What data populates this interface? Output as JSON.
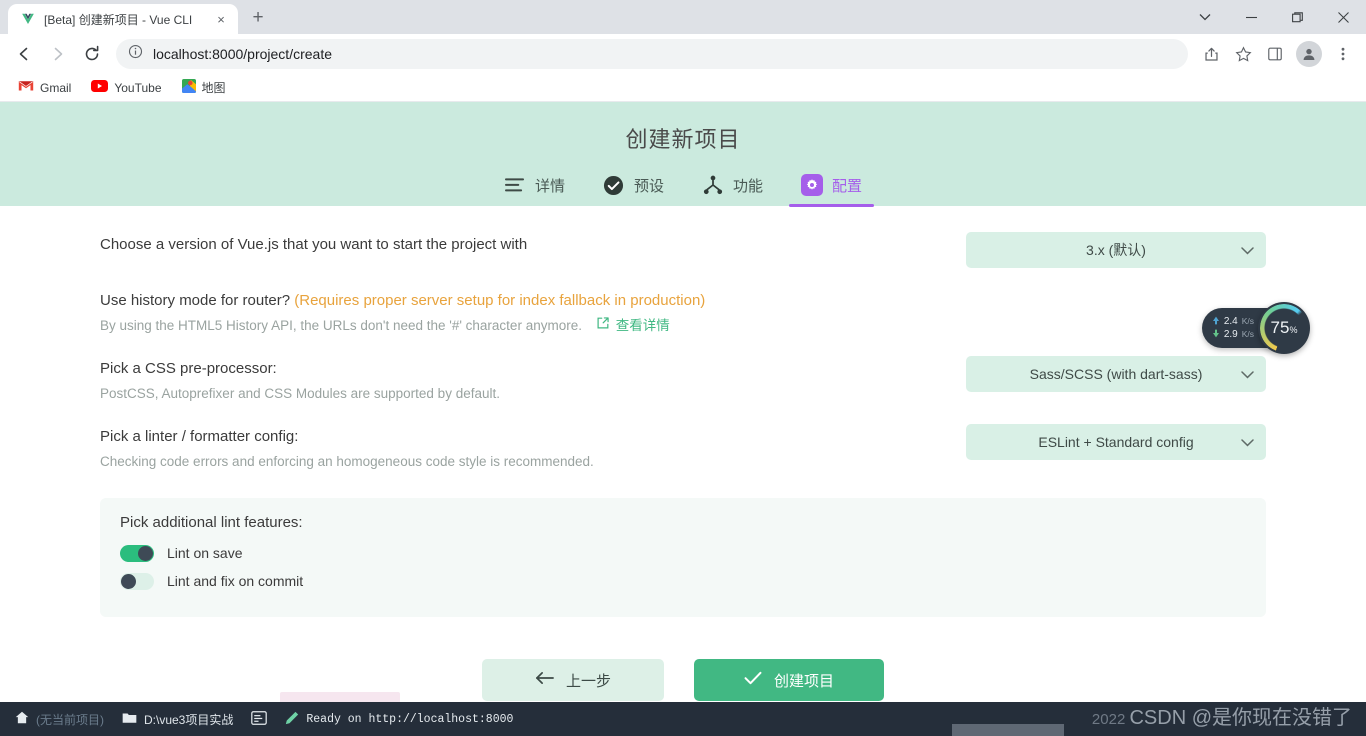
{
  "browser": {
    "tab": {
      "title": "[Beta] 创建新项目 - Vue CLI",
      "favicon": "vue-logo-icon",
      "close": "×"
    },
    "new_tab": "+",
    "window_controls": {
      "tab_search": "⌄",
      "minimize": "—",
      "maximize": "❐",
      "close": "✕"
    },
    "nav": {
      "back": "←",
      "forward": "→",
      "reload": "⟳"
    },
    "omnibox": {
      "info_icon": "ⓘ",
      "url": "localhost:8000/project/create"
    },
    "toolbar_icons": {
      "share": "share-icon",
      "bookmark": "star-icon",
      "side_panel": "side-panel-icon",
      "profile": "profile-avatar",
      "menu": "⋮"
    },
    "bookmarks": [
      {
        "label": "Gmail",
        "icon": "gmail-icon"
      },
      {
        "label": "YouTube",
        "icon": "youtube-icon"
      },
      {
        "label": "地图",
        "icon": "maps-icon"
      }
    ]
  },
  "app": {
    "title": "创建新项目",
    "accent_green": "#41b883",
    "accent_purple": "#a55eea",
    "header_bg": "#cbeade",
    "tabs": [
      {
        "label": "详情",
        "icon": "list-icon",
        "active": false
      },
      {
        "label": "预设",
        "icon": "check-circle-icon",
        "active": false
      },
      {
        "label": "功能",
        "icon": "features-node-icon",
        "active": false
      },
      {
        "label": "配置",
        "icon": "gear-icon",
        "active": true
      }
    ],
    "config_rows": [
      {
        "label": "Choose a version of Vue.js that you want to start the project with",
        "warning": "",
        "desc": "",
        "link": "",
        "select": "3.x (默认)"
      },
      {
        "label": "Use history mode for router?",
        "warning": "(Requires proper server setup for index fallback in production)",
        "desc": "By using the HTML5 History API, the URLs don't need the '#' character anymore.",
        "link": "查看详情",
        "select": ""
      },
      {
        "label": "Pick a CSS pre-processor:",
        "warning": "",
        "desc": "PostCSS, Autoprefixer and CSS Modules are supported by default.",
        "link": "",
        "select": "Sass/SCSS (with dart-sass)"
      },
      {
        "label": "Pick a linter / formatter config:",
        "warning": "",
        "desc": "Checking code errors and enforcing an homogeneous code style is recommended.",
        "link": "",
        "select": "ESLint + Standard config"
      }
    ],
    "lint_panel": {
      "title": "Pick additional lint features:",
      "items": [
        {
          "label": "Lint on save",
          "on": true
        },
        {
          "label": "Lint and fix on commit",
          "on": false
        }
      ]
    },
    "actions": {
      "prev_label": "上一步",
      "prev_icon": "arrow-left-icon",
      "create_label": "创建项目",
      "create_icon": "check-icon"
    }
  },
  "net_widget": {
    "upload": "2.4",
    "upload_unit": "K/s",
    "download": "2.9",
    "download_unit": "K/s",
    "percent": "75",
    "percent_unit": "%"
  },
  "taskbar": {
    "home_icon": "home-icon",
    "project_label": "(无当前项目)",
    "folder_icon": "folder-icon",
    "folder_path": "D:\\vue3项目实战",
    "terminal_icon": "terminal-icon",
    "pen_icon": "pen-icon",
    "status": "Ready on http://localhost:8000",
    "watermark_prefix": "2022",
    "watermark": "CSDN @是你现在没错了"
  }
}
